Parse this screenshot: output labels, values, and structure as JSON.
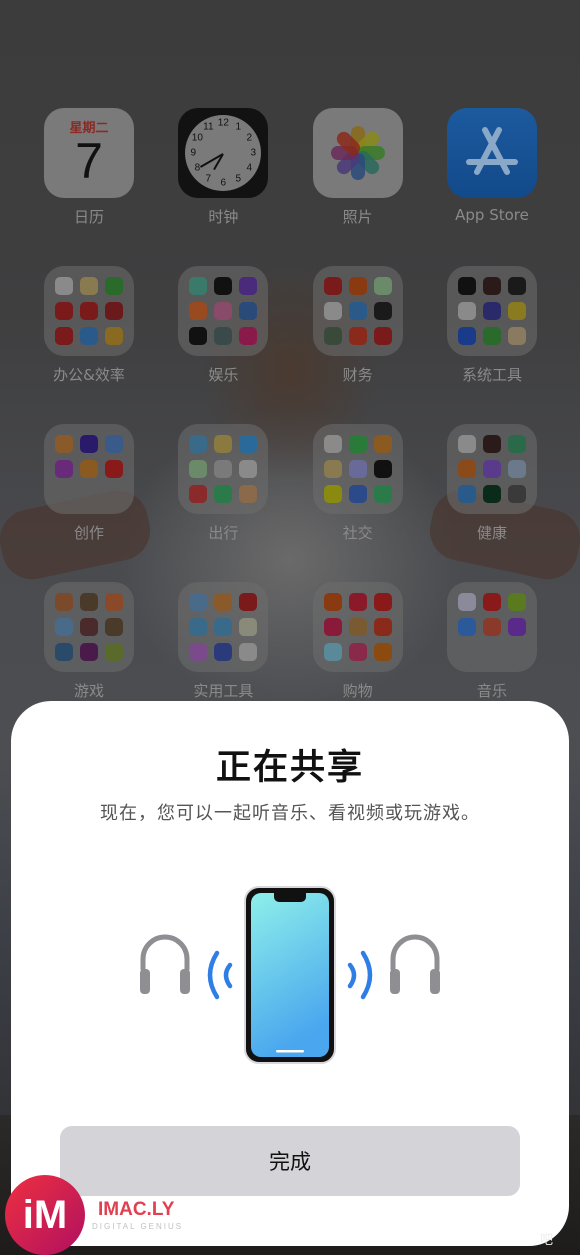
{
  "home_screen": {
    "rows": [
      [
        {
          "name": "app-calendar",
          "label": "日历",
          "type": "calendar",
          "weekday": "星期二",
          "day": "7"
        },
        {
          "name": "app-clock",
          "label": "时钟",
          "type": "clock"
        },
        {
          "name": "app-photos",
          "label": "照片",
          "type": "photos"
        },
        {
          "name": "app-app-store",
          "label": "App Store",
          "type": "appstore"
        }
      ],
      [
        {
          "name": "folder-office",
          "label": "办公&效率",
          "type": "folder",
          "apps": [
            "#8a8a8a",
            "#8a7a50",
            "#2a6a2a",
            "#7a1a1a",
            "#7a1a1a",
            "#6a1a1a",
            "#7a1a1a",
            "#2a5a8a",
            "#8a6a20"
          ]
        },
        {
          "name": "folder-entertainment",
          "label": "娱乐",
          "type": "folder",
          "apps": [
            "#3a7a6a",
            "#111111",
            "#4a2a7a",
            "#9a4a20",
            "#8a4a6a",
            "#2a4a7a",
            "#111111",
            "#3a4a4a",
            "#8a1a4a"
          ]
        },
        {
          "name": "folder-finance",
          "label": "财务",
          "type": "folder",
          "apps": [
            "#7a1a1a",
            "#8a3a10",
            "#6a8a6a",
            "#8a8a8a",
            "#2a5a8a",
            "#1a1a1a",
            "#3a4a3a",
            "#8a2a1a",
            "#7a1a1a"
          ]
        },
        {
          "name": "folder-system-tools",
          "label": "系统工具",
          "type": "folder",
          "apps": [
            "#111111",
            "#2a1a1a",
            "#1a1a1a",
            "#8a8a8a",
            "#2a2a6a",
            "#8a7a20",
            "#1a3a8a",
            "#2a6a2a",
            "#8a7a60"
          ]
        }
      ],
      [
        {
          "name": "folder-creation",
          "label": "创作",
          "type": "folder",
          "apps": [
            "#8a5a2a",
            "#2a1a6a",
            "#3a5a8a",
            "#6a2a7a",
            "#8a5a20",
            "#8a1a1a"
          ]
        },
        {
          "name": "folder-travel",
          "label": "出行",
          "type": "folder",
          "apps": [
            "#3a6a8a",
            "#8a7a40",
            "#2a6a9a",
            "#6a8a6a",
            "#7a7a7a",
            "#8a8a8a",
            "#8a2a2a",
            "#2a7a4a",
            "#8a6a4a"
          ]
        },
        {
          "name": "folder-social",
          "label": "社交",
          "type": "folder",
          "apps": [
            "#8a8a8a",
            "#2a7a3a",
            "#8a5a20",
            "#8a7a50",
            "#6a6a9a",
            "#111111",
            "#8a8a10",
            "#2a4a8a",
            "#2a7a4a"
          ]
        },
        {
          "name": "folder-health",
          "label": "健康",
          "type": "folder",
          "apps": [
            "#8a8a8a",
            "#2a1a1a",
            "#2a6a4a",
            "#8a4a1a",
            "#5a3a8a",
            "#6a7a8a",
            "#2a5a8a",
            "#0a2a1a",
            "#3a3a3a"
          ]
        }
      ],
      [
        {
          "name": "folder-games",
          "label": "游戏",
          "type": "folder",
          "apps": [
            "#7a4a2a",
            "#4a3a2a",
            "#8a4a2a",
            "#4a6a8a",
            "#4a2a2a",
            "#4a3a2a",
            "#2a4a6a",
            "#4a1a4a",
            "#5a6a2a"
          ]
        },
        {
          "name": "folder-utilities",
          "label": "实用工具",
          "type": "folder",
          "apps": [
            "#4a6a8a",
            "#8a5a2a",
            "#7a1a1a",
            "#3a6a8a",
            "#3a6a8a",
            "#8a8a7a",
            "#7a4a8a",
            "#2a3a7a",
            "#8a8a8a"
          ]
        },
        {
          "name": "folder-shopping",
          "label": "购物",
          "type": "folder",
          "apps": [
            "#8a3a10",
            "#8a1a2a",
            "#8a1a1a",
            "#8a1a3a",
            "#7a5a30",
            "#8a2a1a",
            "#5a8a9a",
            "#8a2a4a",
            "#8a4a10"
          ]
        },
        {
          "name": "folder-music",
          "label": "音乐",
          "type": "folder",
          "apps": [
            "#8a8a9a",
            "#8a1a1a",
            "#5a7a20",
            "#2a5a9a",
            "#8a3a2a",
            "#5a2a8a"
          ]
        }
      ]
    ]
  },
  "sheet": {
    "title": "正在共享",
    "subtitle": "现在，您可以一起听音乐、看视频或玩游戏。",
    "illustration": {
      "left_icon": "headphones-icon",
      "right_icon": "headphones-icon",
      "center_icon": "iphone-icon",
      "accent_color": "#2f7ee6",
      "headphone_color": "#8e8e93"
    },
    "done_label": "完成"
  },
  "watermark": {
    "logo_text": "iM",
    "brand": "IMAC.LY",
    "tagline": "DIGITAL GENIUS",
    "right_text": "吧"
  }
}
